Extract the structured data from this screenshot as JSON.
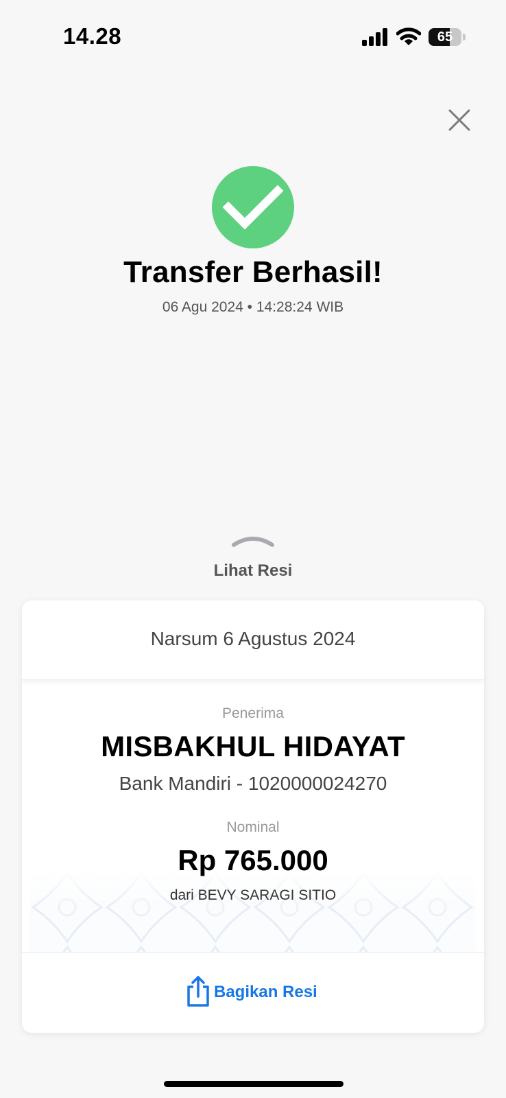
{
  "status_bar": {
    "time": "14.28",
    "battery_level": "65",
    "battery_fraction": 0.65,
    "icons": [
      "cellular-signal-icon",
      "wifi-icon",
      "battery-icon"
    ]
  },
  "header": {
    "close_icon": "close-icon",
    "success_icon": "checkmark-circle-icon",
    "title": "Transfer Berhasil!",
    "datetime": "06 Agu 2024 • 14:28:24 WIB"
  },
  "view_receipt": {
    "icon": "chevron-up-icon",
    "label": "Lihat Resi"
  },
  "receipt": {
    "note": "Narsum 6 Agustus 2024",
    "recipient_label": "Penerima",
    "recipient_name": "MISBAKHUL HIDAYAT",
    "recipient_bank": "Bank Mandiri - 1020000024270",
    "amount_label": "Nominal",
    "amount": "Rp 765.000",
    "sender": "dari BEVY SARAGI SITIO"
  },
  "share": {
    "icon": "share-icon",
    "label": "Bagikan Resi"
  },
  "colors": {
    "success_green": "#5dd17f",
    "link_blue": "#1877e6",
    "background": "#f7f7f7"
  }
}
